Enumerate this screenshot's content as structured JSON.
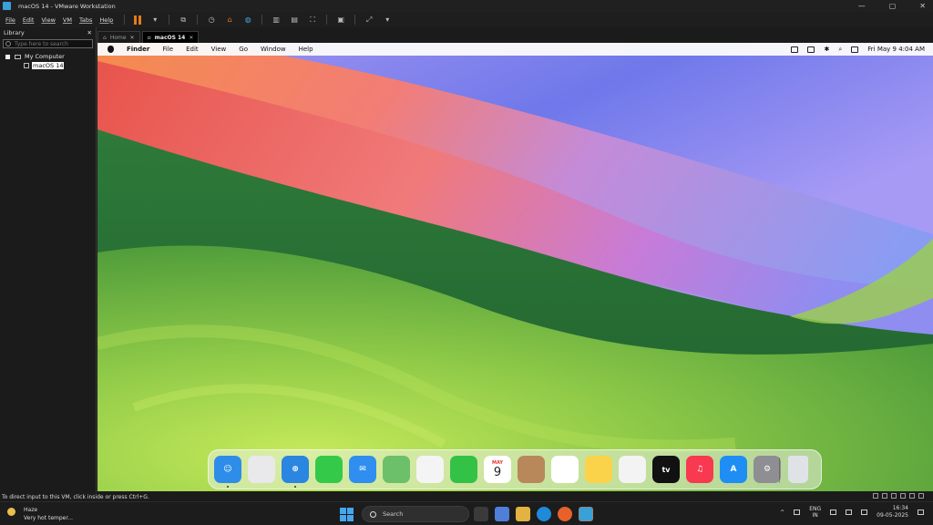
{
  "window": {
    "title": "macOS 14 - VMware Workstation",
    "controls": [
      "—",
      "▢",
      "✕"
    ]
  },
  "menu": [
    "File",
    "Edit",
    "View",
    "VM",
    "Tabs",
    "Help"
  ],
  "toolbar": {
    "icons": [
      "pause-icon",
      "dropdown-icon",
      "send-ctrl-alt-del-icon",
      "snapshot-icon",
      "revert-snapshot-icon",
      "snapshot-manager-icon",
      "show-library-icon",
      "thumbnail-bar-icon",
      "fullscreen-icon",
      "console-view-icon",
      "stretch-icon"
    ]
  },
  "library": {
    "title": "Library",
    "close": "✕",
    "search_placeholder": "Type here to search",
    "tree": [
      {
        "label": "My Computer"
      },
      {
        "label": "macOS 14"
      }
    ]
  },
  "tabs": [
    {
      "label": "Home",
      "close": "✕",
      "active": false
    },
    {
      "label": "macOS 14",
      "close": "✕",
      "active": true
    }
  ],
  "mac_menu": {
    "items": [
      "Finder",
      "File",
      "Edit",
      "View",
      "Go",
      "Window",
      "Help"
    ],
    "datetime": "Fri May 9  4:04 AM"
  },
  "dock": {
    "apps": [
      {
        "name": "Finder",
        "color": "#2e8de8",
        "glyph": "☺",
        "running": true
      },
      {
        "name": "Launchpad",
        "color": "#e9e9ec",
        "glyph": "",
        "running": false
      },
      {
        "name": "Safari",
        "color": "#2a86e0",
        "glyph": "⊕",
        "running": true
      },
      {
        "name": "Messages",
        "color": "#35c94a",
        "glyph": "",
        "running": false
      },
      {
        "name": "Mail",
        "color": "#2f8ef0",
        "glyph": "✉",
        "running": false
      },
      {
        "name": "Maps",
        "color": "#6cc06a",
        "glyph": "",
        "running": false
      },
      {
        "name": "Photos",
        "color": "#f4f4f4",
        "glyph": "",
        "running": false
      },
      {
        "name": "FaceTime",
        "color": "#33c246",
        "glyph": "",
        "running": false
      },
      {
        "name": "Calendar",
        "color": "#ffffff",
        "glyph": "9",
        "month": "MAY",
        "running": false
      },
      {
        "name": "Contacts",
        "color": "#b8875a",
        "glyph": "",
        "running": false
      },
      {
        "name": "Reminders",
        "color": "#ffffff",
        "glyph": "",
        "running": false
      },
      {
        "name": "Notes",
        "color": "#fbd34a",
        "glyph": "",
        "running": false
      },
      {
        "name": "Freeform",
        "color": "#f3f3f3",
        "glyph": "",
        "running": false
      },
      {
        "name": "TV",
        "color": "#111111",
        "glyph": "tv",
        "running": false
      },
      {
        "name": "Music",
        "color": "#f8394f",
        "glyph": "♫",
        "running": false
      },
      {
        "name": "App Store",
        "color": "#1e8ef5",
        "glyph": "A",
        "running": false
      },
      {
        "name": "System Settings",
        "color": "#8e8e93",
        "glyph": "⚙",
        "running": false
      }
    ],
    "trash": {
      "name": "Trash",
      "color": "#dfe3e8"
    }
  },
  "vm_status": "To direct input to this VM, click inside or press Ctrl+G.",
  "taskbar": {
    "weather": {
      "title": "Haze",
      "subtitle": "Very hot temper..."
    },
    "search_placeholder": "Search",
    "lang": {
      "line1": "ENG",
      "line2": "IN"
    },
    "clock": {
      "time": "16:34",
      "date": "09-05-2025"
    }
  },
  "colors": {
    "accent_orange": "#e87a16",
    "titlebar": "#202020",
    "taskbar": "#1c1c1c"
  }
}
